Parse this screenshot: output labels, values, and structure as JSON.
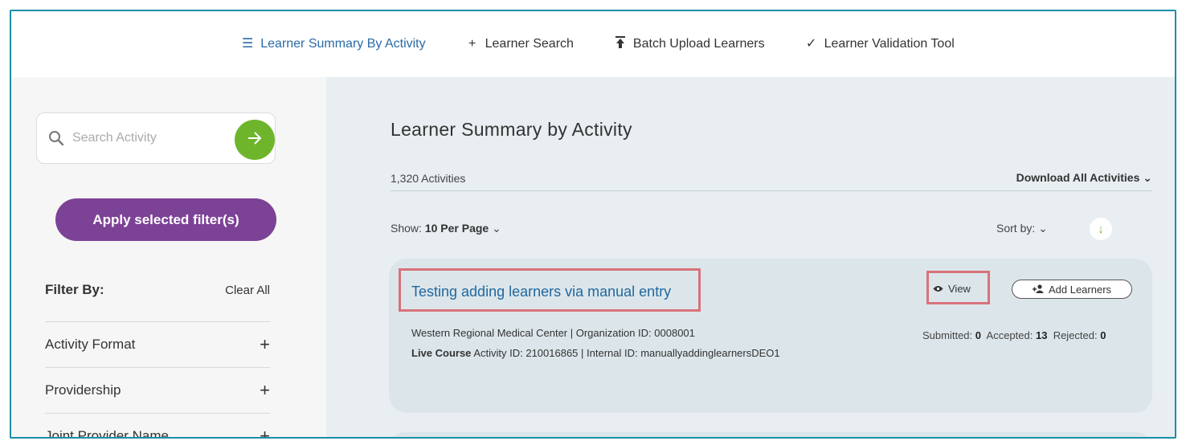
{
  "nav": {
    "items": [
      {
        "label": "Learner Summary By Activity",
        "icon": "list-icon"
      },
      {
        "label": "Learner Search",
        "icon": "plus-icon"
      },
      {
        "label": "Batch Upload Learners",
        "icon": "upload-icon"
      },
      {
        "label": "Learner Validation Tool",
        "icon": "check-icon"
      }
    ]
  },
  "sidebar": {
    "search_placeholder": "Search Activity",
    "apply_label": "Apply selected filter(s)",
    "filter_title": "Filter By:",
    "clear_all": "Clear All",
    "filters": [
      {
        "label": "Activity Format"
      },
      {
        "label": "Providership"
      },
      {
        "label": "Joint Provider Name"
      }
    ]
  },
  "main": {
    "title": "Learner Summary by Activity",
    "count": "1,320 Activities",
    "download_all": "Download All Activities",
    "show_label": "Show:",
    "show_value": "10 Per Page",
    "sort_label": "Sort by:",
    "card": {
      "title": "Testing adding learners via manual entry",
      "view_label": "View",
      "add_learners_label": "Add Learners",
      "org_line": "Western Regional Medical Center | Organization ID: 0008001",
      "course_type": "Live Course",
      "course_line": "Activity ID: 210016865 | Internal ID: manuallyaddinglearnersDEO1",
      "submitted_label": "Submitted:",
      "submitted": "0",
      "accepted_label": "Accepted:",
      "accepted": "13",
      "rejected_label": "Rejected:",
      "rejected": "0"
    }
  },
  "colors": {
    "accent_green": "#6fb52b",
    "accent_purple": "#7c4296",
    "link_blue": "#21679f",
    "highlight_red": "#d8727a",
    "frame_teal": "#1b8fa6"
  }
}
